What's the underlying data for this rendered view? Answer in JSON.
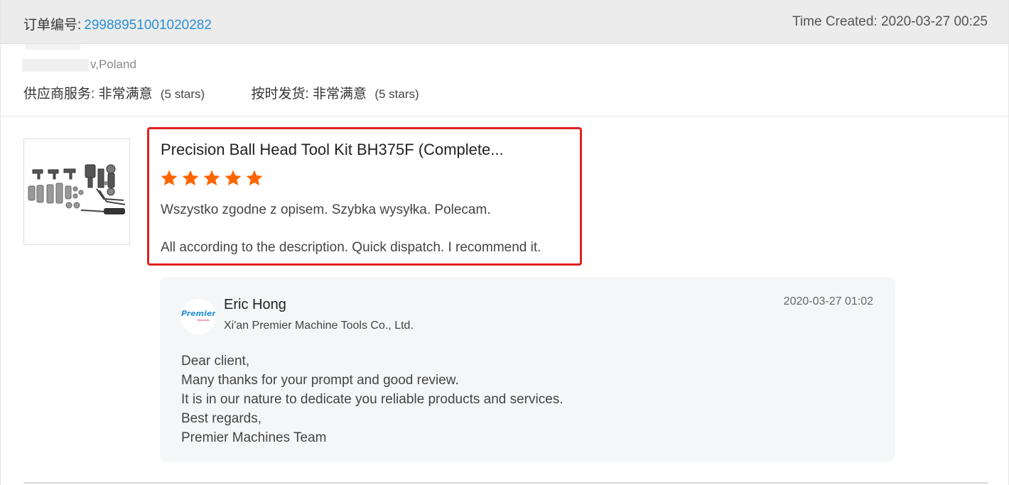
{
  "order": {
    "label": "订单编号:",
    "number": "29988951001020282",
    "time_created": "Time Created: 2020-03-27 00:25"
  },
  "buyer": {
    "country_suffix": "v,Poland"
  },
  "ratings": [
    {
      "label": "供应商服务:",
      "value": "非常满意",
      "stars_text": "(5 stars)"
    },
    {
      "label": "按时发货:",
      "value": "非常满意",
      "stars_text": "(5 stars)"
    }
  ],
  "review": {
    "product_title": "Precision Ball Head Tool Kit BH375F (Complete...",
    "rating": 5,
    "star_color": "#ff6600",
    "original_text": "Wszystko zgodne z opisem. Szybka wysyłka. Polecam.",
    "translated_text": "All according to the description. Quick dispatch. I recommend it."
  },
  "reply": {
    "seller_name": "Eric Hong",
    "company": "Xi'an Premier Machine Tools Co., Ltd.",
    "time": "2020-03-27 01:02",
    "logo_text": "Premier",
    "logo_subtext": "Machines",
    "lines": [
      "Dear client,",
      "Many thanks for your prompt and good review.",
      "It is in our nature to dedicate you reliable products and services.",
      "Best regards,",
      "Premier Machines Team"
    ]
  },
  "colors": {
    "link_blue": "#2a8fd6",
    "highlight_red": "#e02020",
    "header_bg": "#ececec",
    "reply_bg": "#f5f6f7"
  }
}
